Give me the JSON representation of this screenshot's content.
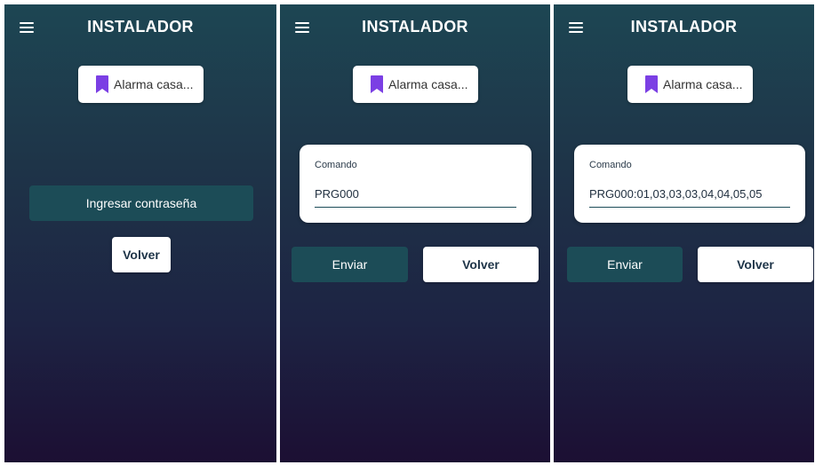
{
  "app": {
    "title": "INSTALADOR"
  },
  "device": {
    "label": "Alarma casa..."
  },
  "screens": [
    {
      "password_button": "Ingresar contraseña",
      "back_button": "Volver"
    },
    {
      "command_label": "Comando",
      "command_value": "PRG000",
      "send_button": "Enviar",
      "back_button": "Volver"
    },
    {
      "command_label": "Comando",
      "command_value": "PRG000:01,03,03,03,04,04,05,05",
      "send_button": "Enviar",
      "back_button": "Volver"
    }
  ],
  "colors": {
    "accent": "#1c4c57",
    "bookmark": "#7b3fe4",
    "bg_top": "#1d4653",
    "bg_bottom": "#1c0f33"
  },
  "icons": {
    "menu": "hamburger-menu-icon",
    "device": "bookmark-icon"
  }
}
